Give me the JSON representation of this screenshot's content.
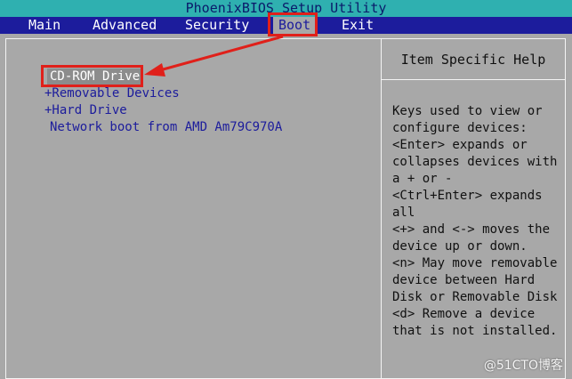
{
  "title_bar": {
    "title": "PhoenixBIOS Setup Utility"
  },
  "menu": {
    "tabs": [
      {
        "label": "Main"
      },
      {
        "label": "Advanced"
      },
      {
        "label": "Security"
      },
      {
        "label": "Boot"
      },
      {
        "label": "Exit"
      }
    ],
    "active": "Boot"
  },
  "boot_list": {
    "items": [
      {
        "label": "CD-ROM Drive"
      },
      {
        "label": "+Removable Devices"
      },
      {
        "label": "+Hard Drive"
      },
      {
        "label": "Network boot from AMD Am79C970A"
      }
    ],
    "selected": "CD-ROM Drive"
  },
  "help": {
    "title": "Item Specific Help",
    "lines": [
      "Keys used to view or",
      "configure devices:",
      "<Enter> expands or",
      "collapses devices with",
      "a + or -",
      "<Ctrl+Enter> expands",
      "all",
      "<+> and <-> moves the",
      "device up or down.",
      "<n> May move removable",
      "device between Hard",
      "Disk or Removable Disk",
      "<d> Remove a device",
      "that is not installed."
    ]
  },
  "watermark": {
    "text": "@51CTO博客"
  },
  "colors": {
    "title_bar_bg": "#2fb0b0",
    "menu_bar_bg": "#1c1c9c",
    "panel_bg": "#a8a8a8",
    "item_text": "#1c1c9c",
    "selected_text": "#ffffff",
    "annotation": "#e0201a"
  }
}
